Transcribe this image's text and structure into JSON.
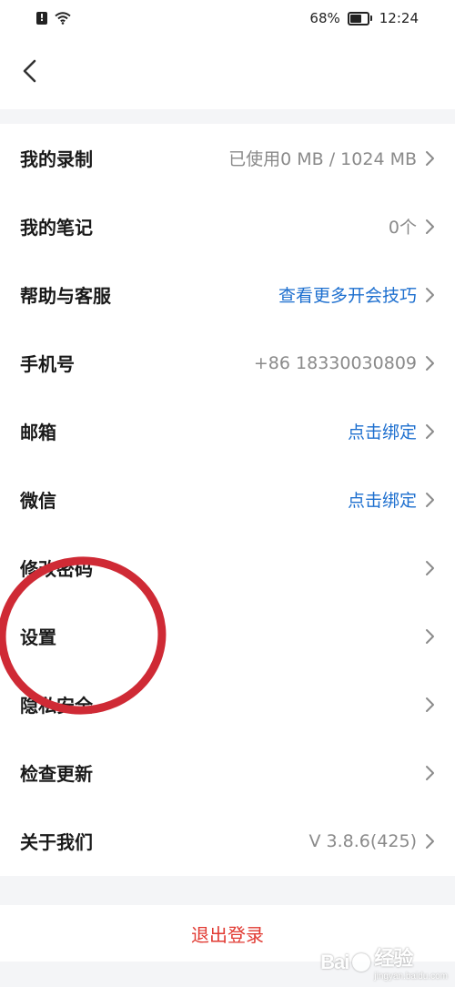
{
  "status_bar": {
    "battery_percent": "68%",
    "battery_level": 0.68,
    "time": "12:24"
  },
  "settings": [
    {
      "key": "recording",
      "label": "我的录制",
      "value": "已使用0 MB / 1024 MB",
      "value_style": "muted"
    },
    {
      "key": "notes",
      "label": "我的笔记",
      "value": "0个",
      "value_style": "muted"
    },
    {
      "key": "help",
      "label": "帮助与客服",
      "value": "查看更多开会技巧",
      "value_style": "link"
    },
    {
      "key": "phone",
      "label": "手机号",
      "value": "+86 18330030809",
      "value_style": "muted"
    },
    {
      "key": "email",
      "label": "邮箱",
      "value": "点击绑定",
      "value_style": "link"
    },
    {
      "key": "wechat",
      "label": "微信",
      "value": "点击绑定",
      "value_style": "link"
    },
    {
      "key": "password",
      "label": "修改密码",
      "value": "",
      "value_style": "muted"
    },
    {
      "key": "settings",
      "label": "设置",
      "value": "",
      "value_style": "muted"
    },
    {
      "key": "privacy",
      "label": "隐私安全",
      "value": "",
      "value_style": "muted"
    },
    {
      "key": "update",
      "label": "检查更新",
      "value": "",
      "value_style": "muted"
    },
    {
      "key": "about",
      "label": "关于我们",
      "value": "V 3.8.6(425)",
      "value_style": "muted"
    }
  ],
  "logout": {
    "label": "退出登录"
  },
  "watermark": {
    "logo": "Bai",
    "suffix": "经验",
    "sub": "jingyan.baidu.com"
  },
  "colors": {
    "link": "#1d6fcf",
    "muted": "#8a8a8a",
    "danger": "#e13a32",
    "separator": "#f4f5f7",
    "annotation": "#cf2a35"
  }
}
